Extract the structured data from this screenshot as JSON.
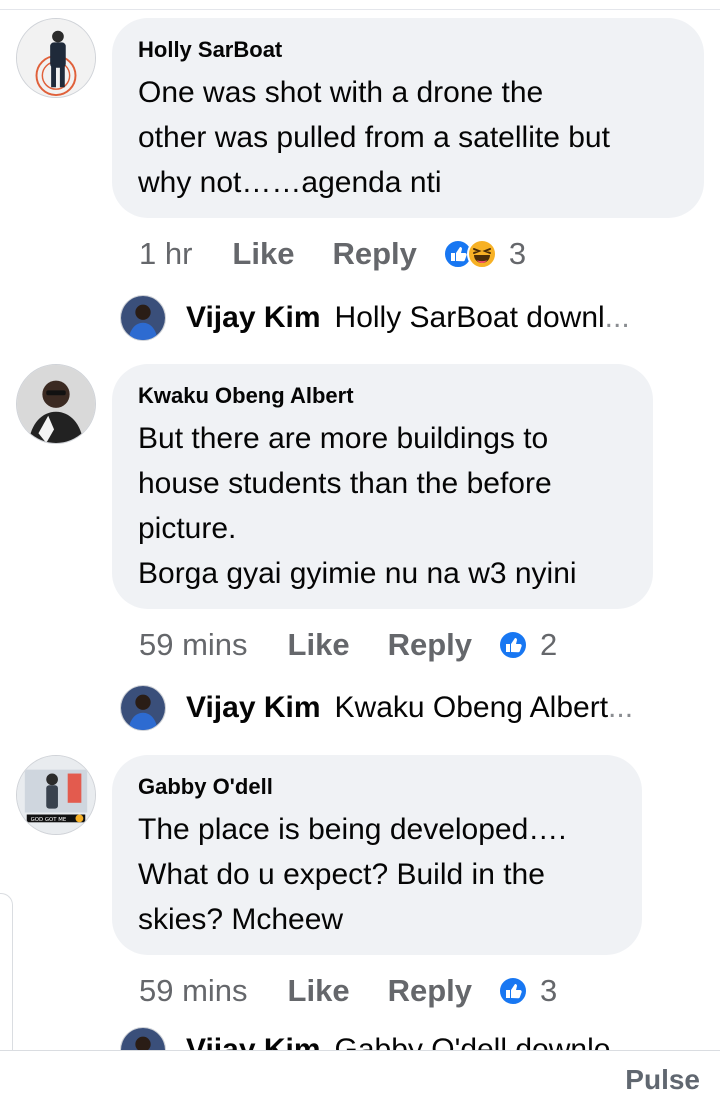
{
  "comments": [
    {
      "author": "Holly SarBoat",
      "text": "One was shot with a drone the\nother was pulled from a satellite but\nwhy not……agenda nti",
      "time": "1 hr",
      "like_label": "Like",
      "reply_label": "Reply",
      "reactions": [
        "like-icon",
        "haha-icon"
      ],
      "reaction_count": "3",
      "reply_preview": {
        "author": "Vijay Kim",
        "text": "Holly SarBoat downl",
        "ellipsis": "..."
      }
    },
    {
      "author": "Kwaku Obeng Albert",
      "text": "But there are more  buildings to\nhouse students than the before\npicture.\nBorga gyai gyimie nu na w3 nyini",
      "time": "59 mins",
      "like_label": "Like",
      "reply_label": "Reply",
      "reactions": [
        "like-icon"
      ],
      "reaction_count": "2",
      "reply_preview": {
        "author": "Vijay Kim",
        "text": "Kwaku Obeng Albert",
        "ellipsis": "..."
      }
    },
    {
      "author": "Gabby O'dell",
      "text": "The place is being developed….\nWhat do u expect? Build in the\nskies? Mcheew",
      "time": "59 mins",
      "like_label": "Like",
      "reply_label": "Reply",
      "reactions": [
        "like-icon"
      ],
      "reaction_count": "3",
      "reply_preview": {
        "author": "Vijay Kim",
        "text": "Gabby O'dell downlo",
        "ellipsis": ""
      }
    }
  ],
  "avatar_caption": "GOD GOT ME",
  "bottom_bar": {
    "label": "Pulse"
  },
  "colors": {
    "bubble": "#f0f2f5",
    "meta_text": "#65676b",
    "like_blue": "#1877f2",
    "haha_yellow": "#f7b125"
  }
}
